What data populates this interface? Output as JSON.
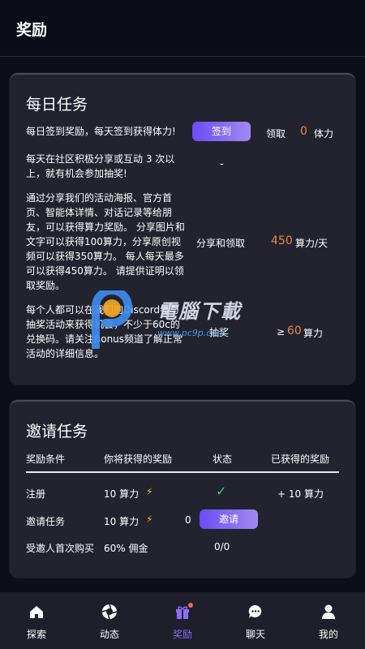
{
  "header": {
    "title": "奖励"
  },
  "daily": {
    "title": "每日任务",
    "tasks": [
      {
        "desc": "每日签到奖励，每天签到获得体力!",
        "button": "签到",
        "claim_label": "领取",
        "amount": "0",
        "unit": "体力"
      },
      {
        "desc": "每天在社区积极分享或互动 3 次以上，就有机会参加抽奖!",
        "value": "-"
      },
      {
        "desc": "通过分享我们的活动海报、官方首页、智能体详情、对话记录等给朋友，可以获得算力奖励。 分享图片和文字可以获得100算力，分享原创视频可以获得350算力。 每人每天最多可以获得450算力。 请提供证明以领取奖励。",
        "action": "分享和领取",
        "amount": "450",
        "unit": "算力/天"
      },
      {
        "desc": "每个人都可以在我们的Discord参与抽奖活动来获得机会，不少于60c的兑换码。请关注Bonus频道了解正常活动的详细信息。",
        "action": "抽奖",
        "prefix": "≥",
        "amount": "60",
        "unit": "算力"
      }
    ]
  },
  "invite": {
    "title": "邀请任务",
    "columns": [
      "奖励条件",
      "你将获得的奖励",
      "状态",
      "已获得的奖励"
    ],
    "rows": [
      {
        "condition": "注册",
        "reward": "10 算力",
        "status_icon": "check-icon",
        "earned": "+ 10 算力"
      },
      {
        "condition": "邀请任务",
        "reward": "10 算力",
        "status": "0",
        "button": "邀请"
      },
      {
        "condition": "受邀人首次购买",
        "reward": "60% 佣金",
        "status": "0/0"
      }
    ]
  },
  "watermark": {
    "text": "電腦下載",
    "url": "www.pc9p.com"
  },
  "tabbar": {
    "items": [
      {
        "label": "探索",
        "icon": "home-icon"
      },
      {
        "label": "动态",
        "icon": "aperture-icon"
      },
      {
        "label": "奖励",
        "icon": "gift-icon",
        "active": true
      },
      {
        "label": "聊天",
        "icon": "chat-bubble-icon"
      },
      {
        "label": "我的",
        "icon": "user-icon"
      }
    ]
  },
  "colors": {
    "accent": "#8c6df7",
    "orange": "#e8894a",
    "check": "#2fd56a",
    "card": "#22232f",
    "background": "#0d0e1a"
  }
}
